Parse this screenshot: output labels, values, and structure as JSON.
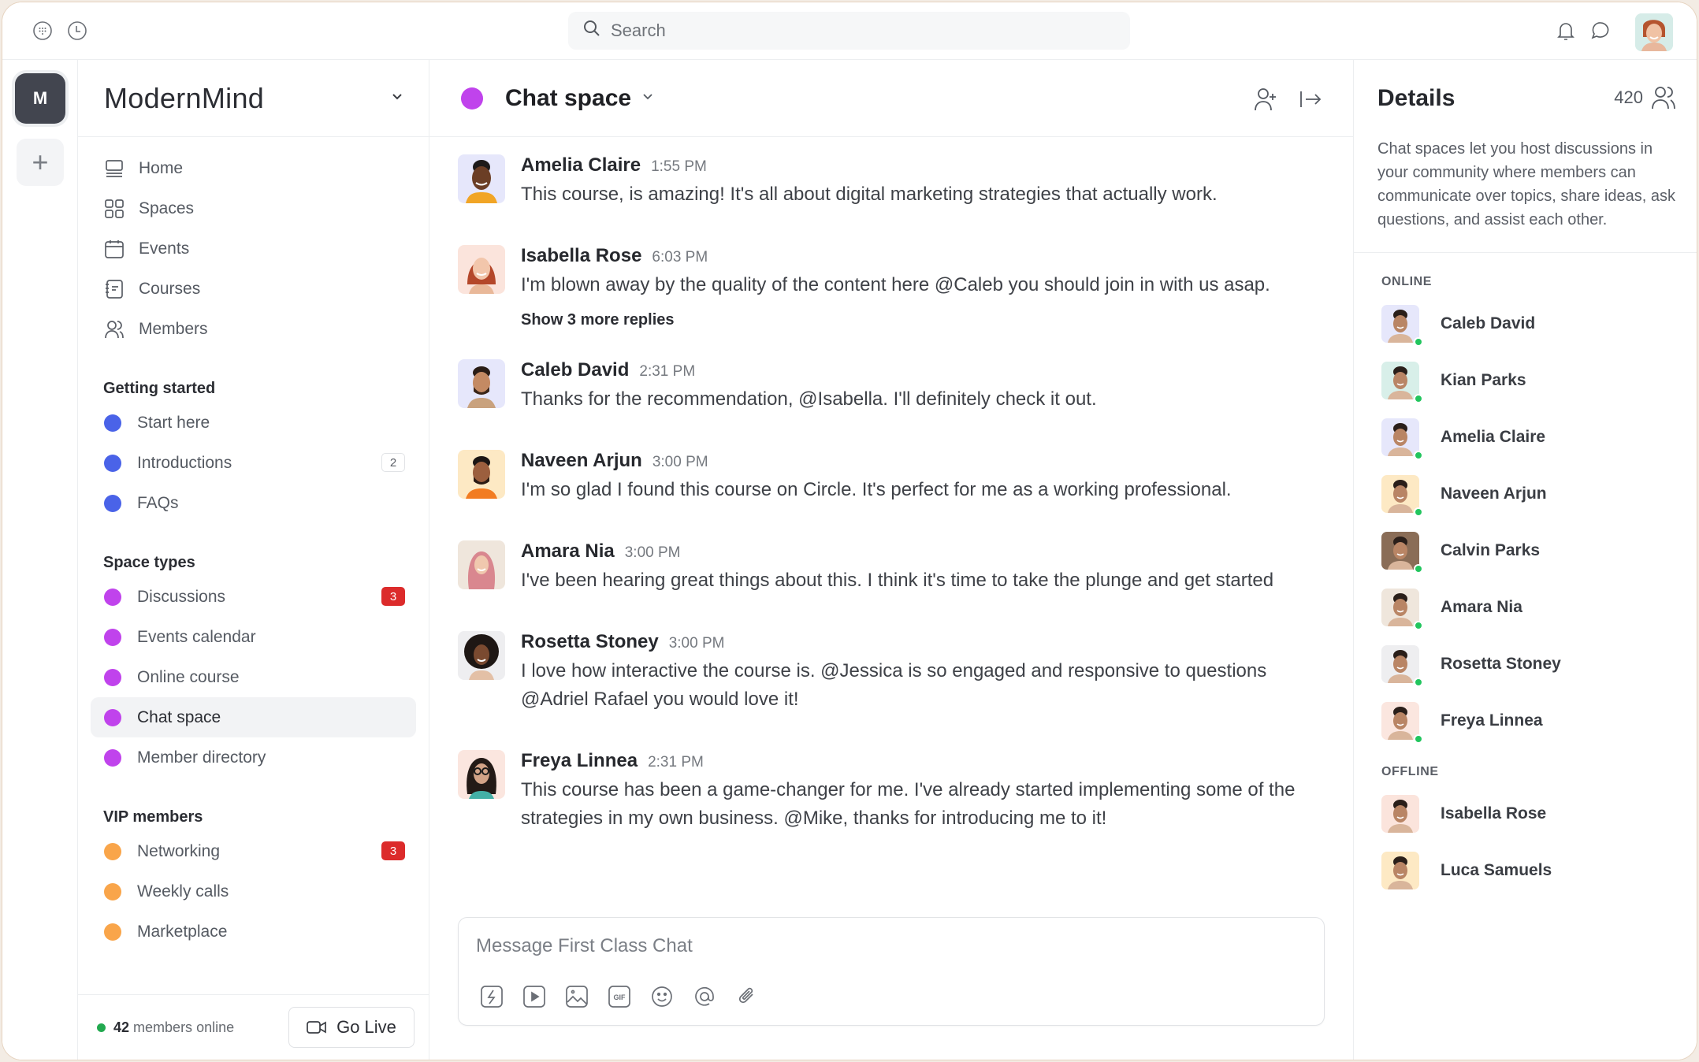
{
  "topbar": {
    "search_placeholder": "Search",
    "icons": [
      "grid-dial-icon",
      "clock-icon",
      "bell-icon",
      "chat-bubble-icon"
    ]
  },
  "rail": {
    "community_initial": "M",
    "add_label": "+"
  },
  "sidebar": {
    "community_name": "ModernMind",
    "nav": [
      {
        "label": "Home",
        "icon": "home-icon"
      },
      {
        "label": "Spaces",
        "icon": "spaces-grid-icon"
      },
      {
        "label": "Events",
        "icon": "calendar-icon"
      },
      {
        "label": "Courses",
        "icon": "notebook-icon"
      },
      {
        "label": "Members",
        "icon": "members-icon"
      }
    ],
    "groups": [
      {
        "title": "Getting started",
        "color": "#4a63e8",
        "items": [
          {
            "label": "Start here",
            "badge": null
          },
          {
            "label": "Introductions",
            "badge": "2",
            "badge_style": "gray"
          },
          {
            "label": "FAQs",
            "badge": null
          }
        ]
      },
      {
        "title": "Space types",
        "color": "#c043ec",
        "items": [
          {
            "label": "Discussions",
            "badge": "3",
            "badge_style": "red"
          },
          {
            "label": "Events calendar",
            "badge": null
          },
          {
            "label": "Online course",
            "badge": null
          },
          {
            "label": "Chat space",
            "badge": null,
            "active": true
          },
          {
            "label": "Member directory",
            "badge": null
          }
        ]
      },
      {
        "title": "VIP members",
        "color": "#f9a54a",
        "items": [
          {
            "label": "Networking",
            "badge": "3",
            "badge_style": "red"
          },
          {
            "label": "Weekly calls",
            "badge": null
          },
          {
            "label": "Marketplace",
            "badge": null
          }
        ]
      }
    ],
    "footer": {
      "online_count": "42",
      "online_label": "members online",
      "go_live_label": "Go Live"
    }
  },
  "chat": {
    "title": "Chat space",
    "accent": "#c043ec",
    "messages": [
      {
        "name": "Amelia Claire",
        "time": "1:55 PM",
        "text": "This course, is amazing! It's all about digital marketing strategies that actually work.",
        "avatar_bg": "#e6e7fb"
      },
      {
        "name": "Isabella Rose",
        "time": "6:03 PM",
        "text": "I'm blown away by the quality of the content here @Caleb you should join in with us asap.",
        "replies": "Show 3 more replies",
        "avatar_bg": "#fbe4dc"
      },
      {
        "name": "Caleb David",
        "time": "2:31 PM",
        "text": "Thanks for the recommendation, @Isabella. I'll definitely check it out.",
        "avatar_bg": "#e6e7fb"
      },
      {
        "name": "Naveen Arjun",
        "time": "3:00 PM",
        "text": "I'm so glad I found this course on Circle. It's perfect for me as a working professional.",
        "avatar_bg": "#fde9c4"
      },
      {
        "name": "Amara Nia",
        "time": "3:00 PM",
        "text": "I've been hearing great things about this. I think it's time to take the plunge and get started",
        "avatar_bg": "#efe6dc"
      },
      {
        "name": "Rosetta Stoney",
        "time": "3:00 PM",
        "text": "I love how interactive the course is. @Jessica is so engaged and responsive to questions @Adriel Rafael you would love it!",
        "avatar_bg": "#eeeef0"
      },
      {
        "name": "Freya Linnea",
        "time": "2:31 PM",
        "text": "This course has been a game-changer for me. I've already started implementing some of the strategies in my own business. @Mike, thanks for introducing me to it!",
        "avatar_bg": "#fbe6df"
      }
    ],
    "composer": {
      "placeholder": "Message First Class Chat",
      "tools": [
        "lightning-icon",
        "video-play-icon",
        "image-icon",
        "gif-icon",
        "emoji-icon",
        "mention-icon",
        "attachment-icon"
      ]
    }
  },
  "details": {
    "title": "Details",
    "member_count": "420",
    "description": "Chat spaces let you host discussions in your community where members can communicate over topics, share ideas, ask questions, and assist each other.",
    "online_label": "ONLINE",
    "offline_label": "OFFLINE",
    "online": [
      {
        "name": "Caleb David",
        "avatar_bg": "#e6e7fb"
      },
      {
        "name": "Kian Parks",
        "avatar_bg": "#d8efe9"
      },
      {
        "name": "Amelia Claire",
        "avatar_bg": "#e6e7fb"
      },
      {
        "name": "Naveen Arjun",
        "avatar_bg": "#fde9c4"
      },
      {
        "name": "Calvin Parks",
        "avatar_bg": "#8a6d57"
      },
      {
        "name": "Amara Nia",
        "avatar_bg": "#efe6dc"
      },
      {
        "name": "Rosetta Stoney",
        "avatar_bg": "#eeeef0"
      },
      {
        "name": "Freya Linnea",
        "avatar_bg": "#fbe6df"
      }
    ],
    "offline": [
      {
        "name": "Isabella Rose",
        "avatar_bg": "#fbe4dc"
      },
      {
        "name": "Luca Samuels",
        "avatar_bg": "#fde9c4"
      }
    ],
    "status_online_color": "#22c55e"
  }
}
